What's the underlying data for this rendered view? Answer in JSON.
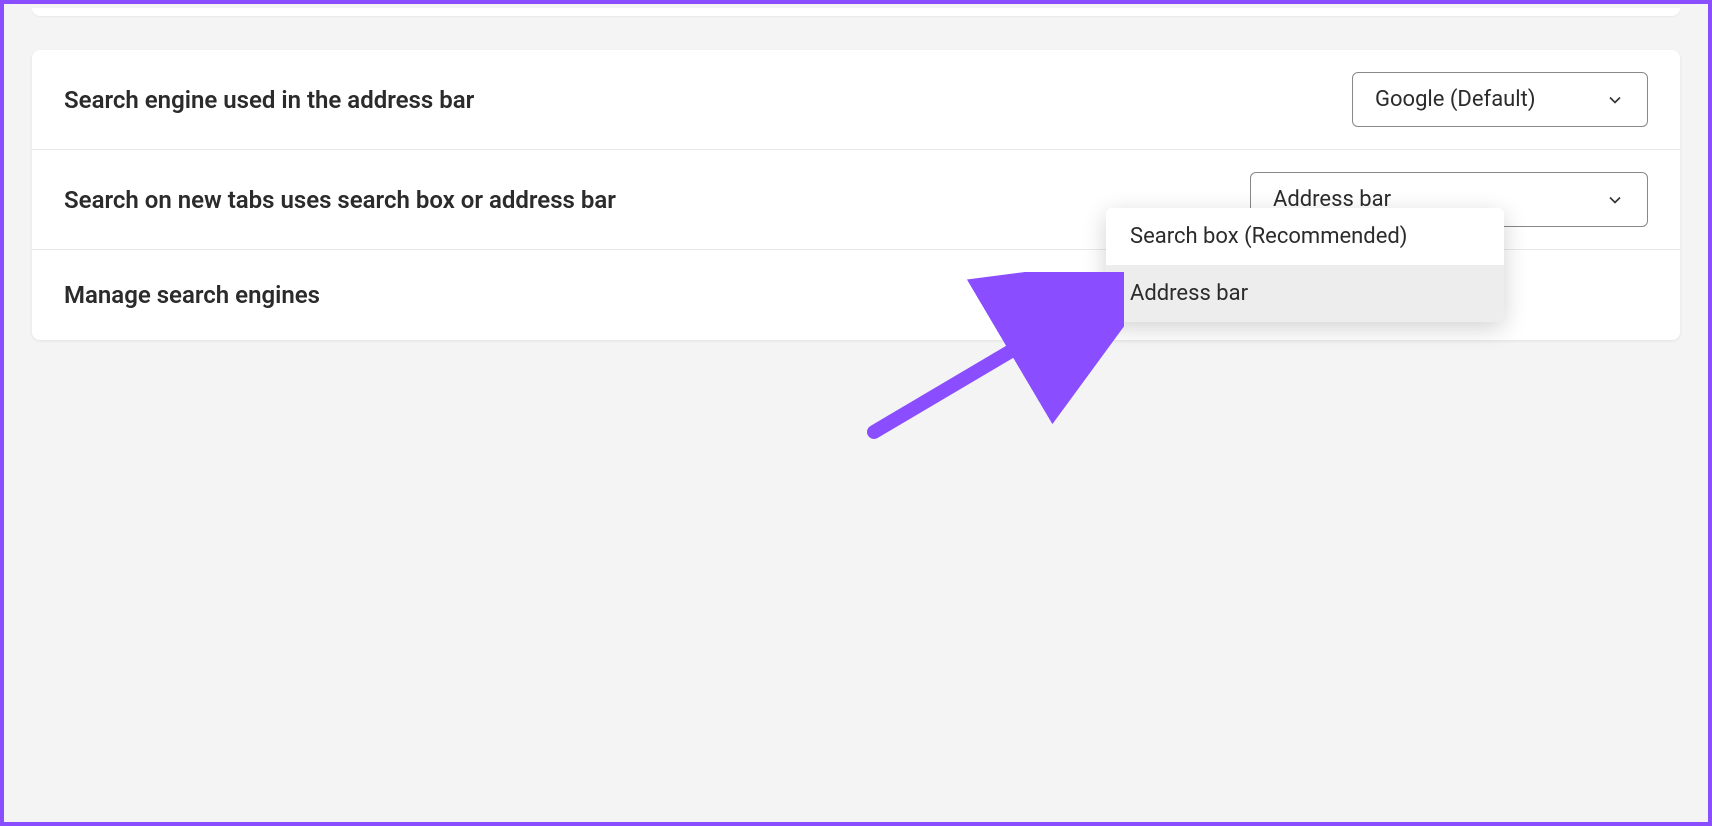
{
  "rows": {
    "search_engine": {
      "label": "Search engine used in the address bar",
      "value": "Google (Default)"
    },
    "new_tab_search": {
      "label": "Search on new tabs uses search box or address bar",
      "value": "Address bar",
      "options": [
        "Search box (Recommended)",
        "Address bar"
      ]
    },
    "manage": {
      "label": "Manage search engines"
    }
  },
  "annotation": {
    "color": "#8a4dff"
  }
}
